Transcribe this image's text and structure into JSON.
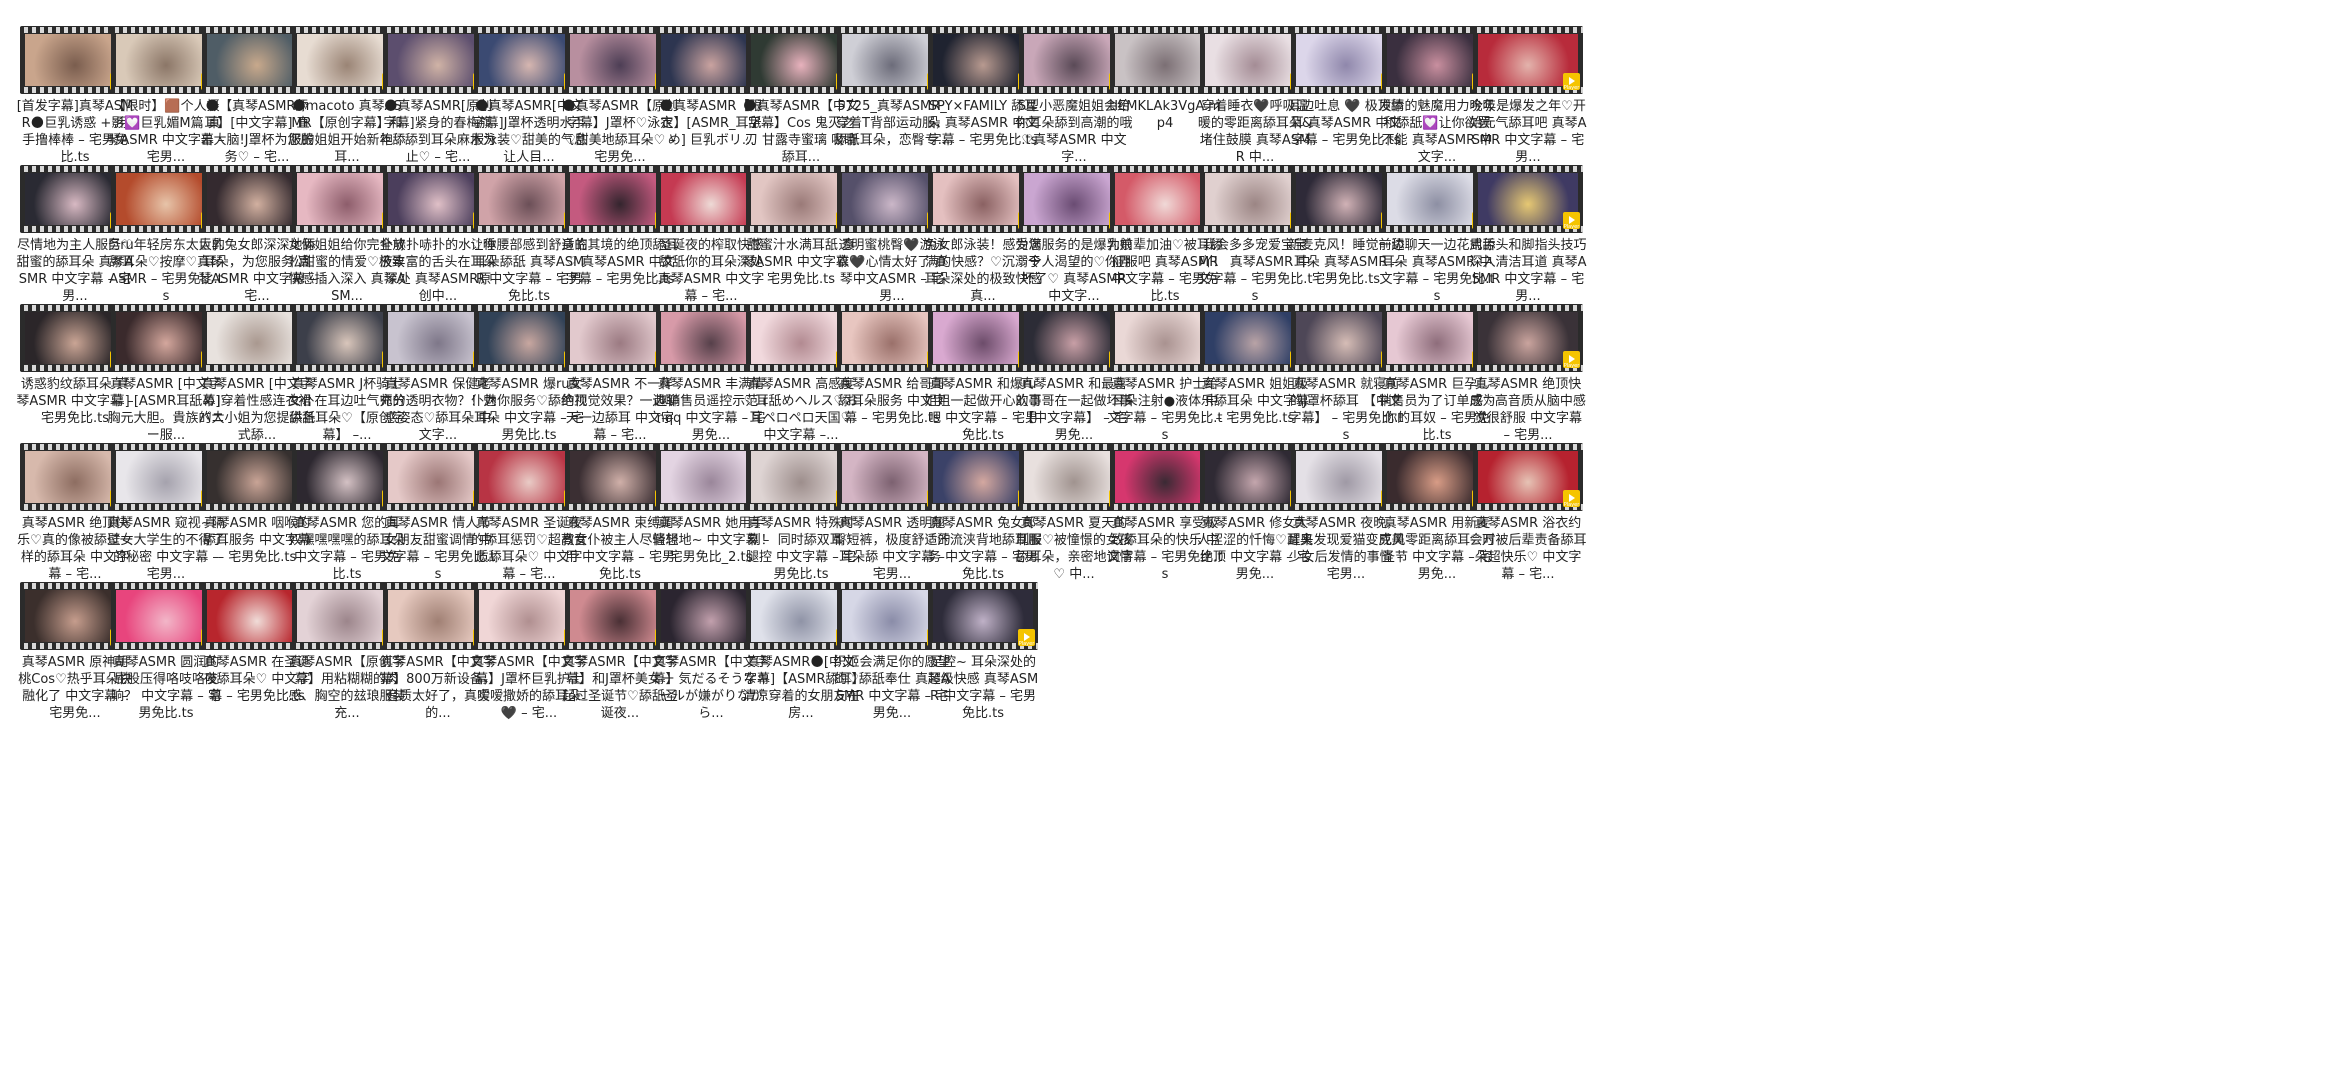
{
  "badge_label": "Player",
  "files": [
    {
      "name": "[首发字幕]真琴ASMR🌑巨乳诱惑 + 用手撸棒棒 – 宅男免比.ts",
      "c1": "#c9a58c",
      "c2": "#7a5d4e"
    },
    {
      "name": "【限时】🟫个人摄影💟巨乳媚M篇 真琴ASMR 中文字幕 – 宅男...",
      "c1": "#d9c9b8",
      "c2": "#8b7667"
    },
    {
      "name": "🌑【真琴ASMR舔耳】[中文字幕] 直击大脑!J罩杯为您服务♡ – 宅...",
      "c1": "#4f5d66",
      "c2": "#c8a98c"
    },
    {
      "name": "🌑macoto 真琴ASMR【原创字幕】和服的姐姐开始新年舔耳...",
      "c1": "#e7dcd2",
      "c2": "#9a8475"
    },
    {
      "name": "🌑真琴ASMR[原创字幕]紧身的春梅旗袍♡舔到耳朵麻木为止♡ – 宅...",
      "c1": "#5c4e6e",
      "c2": "#d0b3a6"
    },
    {
      "name": "🌑真琴ASMR[中文字幕]J罩杯透明水手服泳装♡甜美的气息让人目...",
      "c1": "#3b4a72",
      "c2": "#d6b6b0"
    },
    {
      "name": "🌑真琴ASMR【原创字幕】J罩杯♡泳衣♡甜美地舔耳朵♡ – 宅男免...",
      "c1": "#b88f9f",
      "c2": "#4d3e55"
    },
    {
      "name": "🌑真琴ASMR【限定】[ASMR_耳舐め] 巨乳ボリ...",
      "c1": "#2d3550",
      "c2": "#caa3a0"
    },
    {
      "name": "🌑真琴ASMR【中文字幕】Cos 鬼灭之刃 甘露寺蜜璃 吸睛舔耳...",
      "c1": "#2f3a33",
      "c2": "#e8b2bd"
    },
    {
      "name": "5725_真琴ASMR_穿着T背部运动服，舔舐耳朵，恋臀专...",
      "c1": "#cfcfd6",
      "c2": "#6c6c7a"
    },
    {
      "name": "SPY×FAMILY 舔耳朵 真琴ASMR 中文字幕 – 宅男免比.ts",
      "c1": "#1f2330",
      "c2": "#b89a90"
    },
    {
      "name": "S型小恶魔姐姐会给你耳朵舔到高潮的哦♡真琴ASMR 中文字...",
      "c1": "#c9a7b8",
      "c2": "#5a4a57"
    },
    {
      "name": "tIEMKLAk3VgA.mp4",
      "c1": "#c9c2c4",
      "c2": "#7b6f74"
    },
    {
      "name": "穿着睡衣🖤呼吸温暖的零距离舔耳朵&堵住鼓膜 真琴ASMR 中...",
      "c1": "#e9dfe3",
      "c2": "#a48c95"
    },
    {
      "name": "耳边吐息 🖤 极顶舔耳 真琴ASMR 中文字幕 – 宅男免比.ts",
      "c1": "#dcd6ea",
      "c2": "#8f87ab"
    },
    {
      "name": "发情的魅魔用力吮吸和舔舐💟让你欲罢不能 真琴ASMR 中文字...",
      "c1": "#3a2f3f",
      "c2": "#c98f9f"
    },
    {
      "name": "今年是爆发之年♡开始元气舔耳吧 真琴ASMR 中文字幕 – 宅男...",
      "c1": "#b82b3b",
      "c2": "#e3b3ac"
    },
    {
      "name": "尽情地为主人服务♡甜蜜的舔耳朵 真琴ASMR 中文字幕 – 宅男...",
      "c1": "#2a2a33",
      "c2": "#d8b9c3"
    },
    {
      "name": "巨ru年轻房东太太的舔耳朵♡按摩♡真琴ASMR – 宅男免比.ts",
      "c1": "#b44b2c",
      "c2": "#e7c4a9"
    },
    {
      "name": "巨乳兔女郎深深地舔耳朵，为您服务 真琴ASMR 中文字幕 – 宅...",
      "c1": "#342a2f",
      "c2": "#d2b0a0"
    },
    {
      "name": "女俩姐姐给你完全放松甜蜜的情爱♡极致快感插入深入 真琴ASM...",
      "c1": "#e6b8c2",
      "c2": "#8d5d6b"
    },
    {
      "name": "扑哧扑哧扑的水♡唾液丰富的舌头在耳朵深处 真琴ASMR原创中...",
      "c1": "#4b3e5c",
      "c2": "#e0c0c7"
    },
    {
      "name": "让你腰部感到舒适的耳朵舔舐 真琴ASMR 中文字幕 – 宅男免比.ts",
      "c1": "#d0a3a8",
      "c2": "#6b4f57"
    },
    {
      "name": "身临其境的绝顶舔耳♡ 真琴ASMR 中文字幕 – 宅男免比.ts",
      "c1": "#c45a7f",
      "c2": "#34252e"
    },
    {
      "name": "圣诞夜的榨取快感 舔舐你的耳朵深处 真琴ASMR 中文字幕 – 宅...",
      "c1": "#c53a52",
      "c2": "#eedad6"
    },
    {
      "name": "甜蜜汁水满耳舐 真琴ASMR 中文字幕 – 宅男免比.ts",
      "c1": "#e2c6c3",
      "c2": "#9a7a78"
    },
    {
      "name": "透明蜜桃臀🖤游泳衣🖤心情太好了 真琴中文ASMR – 宅男...",
      "c1": "#55506a",
      "c2": "#cbb7c8"
    },
    {
      "name": "兔女郎泳装！感受满满的快感？♡沉溺于耳朵深处的极致快感 真...",
      "c1": "#e4c0c0",
      "c2": "#8a6162"
    },
    {
      "name": "为您服务的是爆乳娘♡令人渴望的♡你弄坏了♡ 真琴ASMR 中文字...",
      "c1": "#caa6d1",
      "c2": "#6a4c73"
    },
    {
      "name": "为前辈加油♡被耳舔征服吧 真琴ASMR 中文字幕 – 宅男免比.ts",
      "c1": "#d45a68",
      "c2": "#f0d9d7"
    },
    {
      "name": "我会多多宠爱宝宝吖！ 真琴ASMR 中文字幕 – 宅男免比.ts",
      "c1": "#e0d0cf",
      "c2": "#9b8584"
    },
    {
      "name": "新麦克风！睡觉前舔耳朵 真琴ASMR – 宅男免比.ts",
      "c1": "#2e2a38",
      "c2": "#d1b2b6"
    },
    {
      "name": "一边聊天一边花式舔耳朵 真琴ASMR 中文字幕 – 宅男免比.ts",
      "c1": "#dcdce6",
      "c2": "#8d8fa3"
    },
    {
      "name": "用舌头和脚指头技巧深入清洁耳道 真琴ASMR 中文字幕 – 宅男...",
      "c1": "#3f3a63",
      "c2": "#e6c873"
    },
    {
      "name": "诱惑豹纹舔耳朵 真琴ASMR 中文字幕 – 宅男免比.ts",
      "c1": "#2b2629",
      "c2": "#caa595"
    },
    {
      "name": "真琴ASMR [中文字幕] [ASMR耳舐め] 胸元大胆。貴族バニー服...",
      "c1": "#3a2a2c",
      "c2": "#d4a79d"
    },
    {
      "name": "真琴ASMR [中文字幕]穿着性感连衣裙的大小姐为您提供各式舔...",
      "c1": "#e8e2de",
      "c2": "#a9988f"
    },
    {
      "name": "真琴ASMR J杯骑士女仆在耳边吐气充分舔舐耳朵♡【原创字幕】 –...",
      "c1": "#3c3f4a",
      "c2": "#d9c6bb"
    },
    {
      "name": "真琴ASMR 保健老师的透明衣物？！魅惑姿态♡舔耳朵 中文字...",
      "c1": "#c8c3cf",
      "c2": "#7e7789"
    },
    {
      "name": "真琴ASMR 爆ru女仆为你服务♡舔绝顶耳朵 中文字幕 – 宅男免比.ts",
      "c1": "#314257",
      "c2": "#c8a7a0"
    },
    {
      "name": "真琴ASMR 不一样的视觉效果？一边聊天一边舔耳 中文字幕 – 宅...",
      "c1": "#e2c9cd",
      "c2": "#9b7a82"
    },
    {
      "name": "真琴ASMR 丰满情趣销售员遥控示范 rnqq 中文字幕 – 宅男免...",
      "c1": "#d79aa8",
      "c2": "#56404a"
    },
    {
      "name": "真琴ASMR 高感度♡耳舐めヘルス♡お耳ペロペロ天国♡ 中文字幕 –...",
      "c1": "#f1d9dd",
      "c2": "#b28a91"
    },
    {
      "name": "真琴ASMR 给哥哥舔耳朵服务 中文字幕 – 宅男免比.ts",
      "c1": "#e8c6c0",
      "c2": "#9a706a"
    },
    {
      "name": "真琴ASMR 和爆ru姐姐一起做开心的事吧 中文字幕 – 宅男免比.ts",
      "c1": "#d9a9d0",
      "c2": "#6c4c6a"
    },
    {
      "name": "真琴ASMR 和最喜欢哥哥在一起做坏事 【中文字幕】 – 宅男免...",
      "c1": "#2c2c36",
      "c2": "#c89fa6"
    },
    {
      "name": "真琴ASMR 护士给耳朵注射●液体 中文字幕 – 宅男免比.ts",
      "c1": "#ead8d6",
      "c2": "#a99290"
    },
    {
      "name": "真琴ASMR 姐姐极乐舔耳朵 中文字幕 – 宅男免比.ts",
      "c1": "#2f3f66",
      "c2": "#b9a3a6"
    },
    {
      "name": "真琴ASMR 就寝前的J罩杯舔耳 【中文字幕】 – 宅男免比.ts",
      "c1": "#4e4757",
      "c2": "#d6bdb6"
    },
    {
      "name": "真琴ASMR 巨孕乚销售员为了订单成为你的耳奴 – 宅男免比.ts",
      "c1": "#e6c8d3",
      "c2": "#8e6d7b"
    },
    {
      "name": "真琴ASMR 绝顶快感♡高音质从脑中感觉很舒服 中文字幕 – 宅男...",
      "c1": "#3a3238",
      "c2": "#caa49e"
    },
    {
      "name": "真琴ASMR 绝顶快乐♡真的像被舔过一样的舔耳朵 中文字幕 – 宅...",
      "c1": "#d7b9ac",
      "c2": "#8d6d61"
    },
    {
      "name": "真琴ASMR 窥视~隔壁女大学生的不得了的秘密 中文字幕 – 宅男...",
      "c1": "#e8e6ea",
      "c2": "#a5a2ad"
    },
    {
      "name": "真琴ASMR 咽喉的舔耳服务 中文字幕 – 宅男免比.ts",
      "c1": "#36302f",
      "c2": "#c9a496"
    },
    {
      "name": "真琴ASMR 您的耳奴嘿嘿嘿嘿的舔耳朵 中文字幕 – 宅男免比.ts",
      "c1": "#2d2830",
      "c2": "#d4c1c4"
    },
    {
      "name": "真琴ASMR 情人节女朋友甜蜜调情 中文字幕 – 宅男免比.ts",
      "c1": "#e5c9c8",
      "c2": "#9b7675"
    },
    {
      "name": "真琴ASMR 圣诞夜的舔耳惩罚♡超高音质舔耳朵♡ 中文字幕 – 宅...",
      "c1": "#b83444",
      "c2": "#e9cbc6"
    },
    {
      "name": "真琴ASMR 束缚调教女仆被主人尽情想用 中文字幕 – 宅男免比.ts",
      "c1": "#3b2f33",
      "c2": "#d0b0a9"
    },
    {
      "name": "真琴ASMR 她用手轻轻地~ 中文字幕 – 宅男免比_2.ts",
      "c1": "#e3d4e2",
      "c2": "#9a869a"
    },
    {
      "name": "真琴ASMR 特殊时刻！ 同时舔双耳♡腿控 中文字幕 – 宅男免比.ts",
      "c1": "#ded4d3",
      "c2": "#9d8e8c"
    },
    {
      "name": "真琴ASMR 透明翘臀短裤，极度舒适的耳朵舔 中文字幕 – 宅男...",
      "c1": "#d4b5c4",
      "c2": "#7c6170"
    },
    {
      "name": "真琴ASMR 兔女郎♡汗流浃背地舔耳服务 中文字幕 – 宅男免比.ts",
      "c1": "#3b4268",
      "c2": "#d4a8a0"
    },
    {
      "name": "真琴ASMR 夏天的制服♡被憧憬的女孩舔耳朵，亲密地调情♡ 中...",
      "c1": "#e8e0de",
      "c2": "#a0938f"
    },
    {
      "name": "真琴ASMR 享受极致舔耳朵的快乐 中文字幕 – 宅男免比.ts",
      "c1": "#d6376e",
      "c2": "#3a2a34"
    },
    {
      "name": "真琴ASMR 修女大人涩涩的忏悔♡耳奥绝顶 中文字幕 – 宅男免...",
      "c1": "#2f2a34",
      "c2": "#c4a6ad"
    },
    {
      "name": "真琴ASMR 夜晚，醒来发现爱猫变成美少女后发情的事情 – 宅男...",
      "c1": "#e4e0e6",
      "c2": "#9f99a5"
    },
    {
      "name": "真琴ASMR 用新麦克风零距离舔耳♡万圣节 中文字幕 – 宅男免...",
      "c1": "#3a2b2e",
      "c2": "#d89c86"
    },
    {
      "name": "真琴ASMR 浴衣约会时被后辈责备舔耳朵超快乐♡ 中文字幕 – 宅...",
      "c1": "#b6222f",
      "c2": "#e6c3b5"
    },
    {
      "name": "真琴ASMR 原神胡桃Cos♡热乎耳朵快融化了 中文字幕 – 宅男免...",
      "c1": "#3b2f2c",
      "c2": "#c69d8d"
    },
    {
      "name": "真琴ASMR 圆润的屁股压得咯吱咯吱响？ 中文字幕 – 宅男免比.ts",
      "c1": "#e8457d",
      "c2": "#f2b6c8"
    },
    {
      "name": "真琴ASMR 在圣诞夜舔耳朵♡ 中文字幕 – 宅男免比.ts",
      "c1": "#b8262d",
      "c2": "#f0dcd8"
    },
    {
      "name": "真琴ASMR【原创字幕】用粘糊糊的肉感、胸空的玆琅服装充...",
      "c1": "#e3d2d6",
      "c2": "#9c858b"
    },
    {
      "name": "真琴ASMR【中文字幕】800万新设备，音质太好了，真实的...",
      "c1": "#e6c9bf",
      "c2": "#a08074"
    },
    {
      "name": "真琴ASMR【中文字幕】J罩杯巨乳护士嗳嗳撒娇的舔耳朵 🖤 – 宅...",
      "c1": "#f0d6d6",
      "c2": "#b08f90"
    },
    {
      "name": "真琴ASMR【中文字幕】和J罩杯美女一起过圣诞节♡舔舐圣诞夜...",
      "c1": "#cf8a90",
      "c2": "#4a3035"
    },
    {
      "name": "真琴ASMR【中文字幕】気だるそうなキャルが嫌がりながら...",
      "c1": "#2b2530",
      "c2": "#c2a0ad"
    },
    {
      "name": "真琴ASMR🌑[中文字幕]【ASMR舔耳】清凉穿着的女朋友在房...",
      "c1": "#dfe1ea",
      "c2": "#8f93a6"
    },
    {
      "name": "织姬会满足你的愿望的♡舔舐奉仕 真琴ASMR 中文字幕 – 宅男免...",
      "c1": "#d6d7e6",
      "c2": "#8a8ca8"
    },
    {
      "name": "足控~ 耳朵深处的超级快感 真琴ASMR 中文字幕 – 宅男免比.ts",
      "c1": "#2e2c3a",
      "c2": "#bfb1c7"
    }
  ]
}
